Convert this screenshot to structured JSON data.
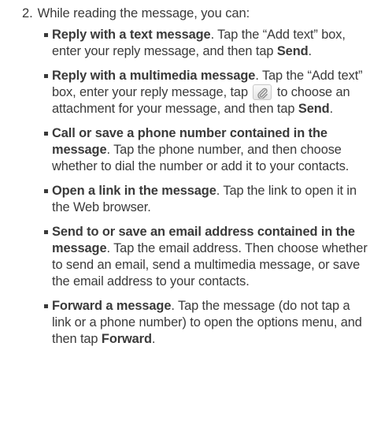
{
  "step": {
    "number": "2.",
    "text": "While reading the message, you can:"
  },
  "items": [
    {
      "lead": "Reply with a text message",
      "parts": [
        ". Tap the “Add text” box, enter your reply message, and then tap ",
        "Send",
        "."
      ]
    },
    {
      "lead": "Reply with a multimedia message",
      "parts": [
        ". Tap the “Add text” box, enter your reply message, tap ",
        " to choose an attachment for your message, and then tap ",
        "Send",
        "."
      ]
    },
    {
      "lead": "Call or save a phone number contained in the message",
      "parts": [
        ". Tap the phone number, and then choose whether to dial the number or add it to your contacts."
      ]
    },
    {
      "lead": "Open a link in the message",
      "parts": [
        ". Tap the link to open it in the Web browser."
      ]
    },
    {
      "lead": "Send to or save an email address contained in the message",
      "parts": [
        ". Tap the email address. Then choose whether to send an email, send a multimedia message, or save the email address to your contacts."
      ]
    },
    {
      "lead": "Forward a message",
      "parts": [
        ". Tap the message (do not tap a link or a phone number) to open the options menu, and then tap ",
        "Forward",
        "."
      ]
    }
  ],
  "icons": {
    "attachment": "paperclip-icon"
  }
}
